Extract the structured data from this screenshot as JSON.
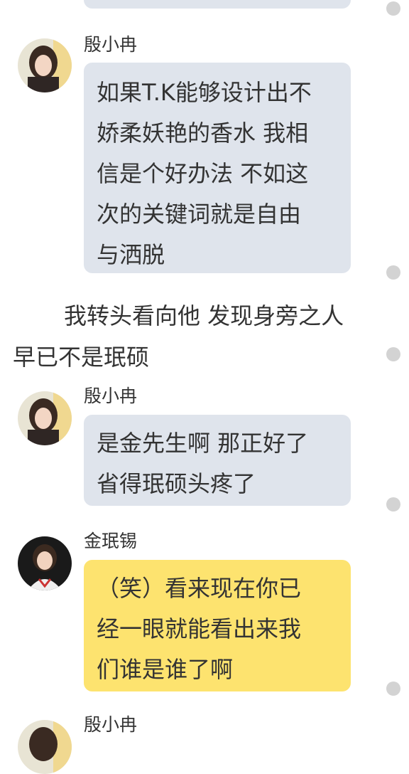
{
  "chat": {
    "msg1": {
      "sender": "殷小冉",
      "lines": [
        "如果T.K能够设计出不",
        "娇柔妖艳的香水 我相",
        "信是个好办法 不如这",
        "次的关键词就是自由",
        "与洒脱"
      ]
    },
    "narration": {
      "line1": "我转头看向他 发现身旁之人",
      "line2": "早已不是珉硕"
    },
    "msg2": {
      "sender": "殷小冉",
      "lines": [
        "是金先生啊 那正好了",
        "省得珉硕头疼了"
      ]
    },
    "msg3": {
      "sender": "金珉锡",
      "lines": [
        "（笑）看来现在你已",
        "经一眼就能看出来我",
        "们谁是谁了啊"
      ]
    },
    "msg4": {
      "sender": "殷小冉"
    }
  },
  "colors": {
    "bubble_gray": "#dfe4ec",
    "bubble_yellow": "#fde36f",
    "dot_gray": "#d3d3d3"
  },
  "icons": {
    "avatar_yin": "avatar-girl-photo",
    "avatar_jin": "avatar-boy-photo",
    "dot": "circle-dot"
  }
}
